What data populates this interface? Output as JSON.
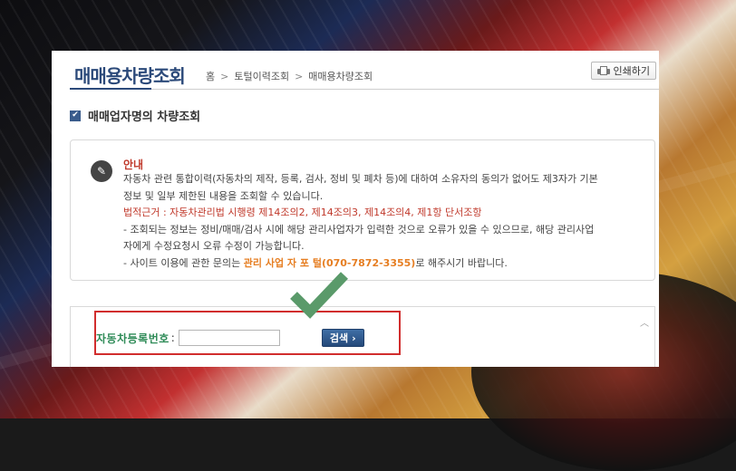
{
  "header": {
    "title": "매매용차량조회",
    "breadcrumb": [
      "홈",
      "토털이력조회",
      "매매용차량조회"
    ],
    "print_label": "인쇄하기"
  },
  "section": {
    "title": "매매업자명의 차량조회"
  },
  "notice": {
    "heading": "안내",
    "line1": "자동차 관련 통합이력(자동차의 제작, 등록, 검사, 정비 및 폐차 등)에 대하여 소유자의 동의가 없어도 제3자가 기본",
    "line2": "정보 및 일부 제한된 내용을 조회할 수 있습니다.",
    "legal": "법적근거 : 자동차관리법 시행령 제14조의2, 제14조의3, 제14조의4, 제1항 단서조항",
    "line4": "- 조회되는 정보는 정비/매매/검사 시에 해당 관리사업자가 입력한 것으로 오류가 있을 수 있으므로, 해당 관리사업",
    "line5": "자에게 수정요청시 오류 수정이 가능합니다.",
    "line6_prefix": "- 사이트 이용에 관한 문의는 ",
    "line6_portal": "관리 사업 자 포 털(070-7872-3355)",
    "line6_suffix": "로 해주시기 바랍니다."
  },
  "search": {
    "label": "자동차등록번호",
    "colon": ":",
    "input_value": "",
    "button_label": "검색",
    "button_arrow": "›"
  },
  "icons": {
    "print": "printer-icon",
    "section": "checkbox-icon",
    "info": "pencil-icon",
    "scroll": "chevron-up-icon",
    "annotation": "checkmark-icon"
  },
  "colors": {
    "title": "#2c4a7a",
    "legal_red": "#c0392b",
    "portal_orange": "#e67e22",
    "label_green": "#2e8b57",
    "button_blue": "#24497a",
    "highlight_red": "#d12d2d",
    "check_green": "#5a9a6a"
  }
}
